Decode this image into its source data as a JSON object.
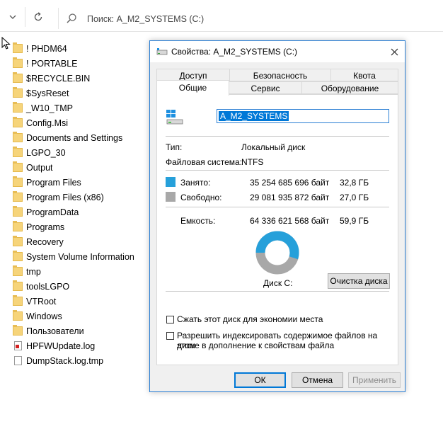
{
  "explorer": {
    "search_placeholder": "Поиск: A_M2_SYSTEMS (C:)",
    "files": [
      {
        "name": "! PHDM64",
        "icon": "folder-icon"
      },
      {
        "name": "! PORTABLE",
        "icon": "folder-icon"
      },
      {
        "name": "$RECYCLE.BIN",
        "icon": "folder-icon"
      },
      {
        "name": "$SysReset",
        "icon": "folder-icon"
      },
      {
        "name": "_W10_TMP",
        "icon": "folder-icon"
      },
      {
        "name": "Config.Msi",
        "icon": "folder-icon"
      },
      {
        "name": "Documents and Settings",
        "icon": "folder-shortcut-icon"
      },
      {
        "name": "LGPO_30",
        "icon": "folder-icon"
      },
      {
        "name": "Output",
        "icon": "folder-icon"
      },
      {
        "name": "Program Files",
        "icon": "folder-icon"
      },
      {
        "name": "Program Files (x86)",
        "icon": "folder-icon"
      },
      {
        "name": "ProgramData",
        "icon": "folder-icon"
      },
      {
        "name": "Programs",
        "icon": "folder-icon"
      },
      {
        "name": "Recovery",
        "icon": "folder-icon"
      },
      {
        "name": "System Volume Information",
        "icon": "folder-icon"
      },
      {
        "name": "tmp",
        "icon": "folder-icon"
      },
      {
        "name": "toolsLGPO",
        "icon": "folder-icon"
      },
      {
        "name": "VTRoot",
        "icon": "folder-icon"
      },
      {
        "name": "Windows",
        "icon": "folder-icon"
      },
      {
        "name": "Пользователи",
        "icon": "folder-icon"
      },
      {
        "name": "HPFWUpdate.log",
        "icon": "log-file-icon"
      },
      {
        "name": "DumpStack.log.tmp",
        "icon": "file-icon"
      }
    ]
  },
  "dialog": {
    "title": "Свойства: A_M2_SYSTEMS (C:)",
    "tabs_row1": [
      "Доступ",
      "Безопасность",
      "Квота"
    ],
    "tabs_row2": [
      "Общие",
      "Сервис",
      "Оборудование"
    ],
    "drive_name": "A_M2_SYSTEMS",
    "type_label": "Тип:",
    "type_value": "Локальный диск",
    "fs_label": "Файловая система:",
    "fs_value": "NTFS",
    "used_label": "Занято:",
    "used_bytes": "35 254 685 696 байт",
    "used_gb": "32,8 ГБ",
    "free_label": "Свободно:",
    "free_bytes": "29 081 935 872 байт",
    "free_gb": "27,0 ГБ",
    "capacity_label": "Емкость:",
    "capacity_bytes": "64 336 621 568 байт",
    "capacity_gb": "59,9 ГБ",
    "drive_label": "Диск C:",
    "cleanup_button": "Очистка диска",
    "compress_label": "Сжать этот диск для экономии места",
    "index_label_line1": "Разрешить индексировать содержимое файлов на этом",
    "index_label_line2": "диске в дополнение к свойствам файла",
    "ok_button": "ОК",
    "cancel_button": "Отмена",
    "apply_button": "Применить",
    "used_fraction": 0.548,
    "colors": {
      "used": "#26a0da",
      "free": "#a8a8a8",
      "accent": "#0078d7"
    }
  }
}
